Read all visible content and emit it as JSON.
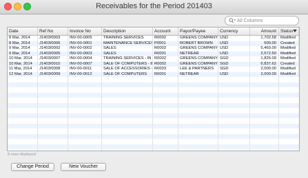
{
  "window": {
    "title": "Receivables for the Period 201403"
  },
  "search": {
    "placeholder": "All Columns"
  },
  "table": {
    "columns": [
      "Date",
      "Ref No",
      "Invoice No",
      "Description",
      "Account",
      "Payor/Payee",
      "Currency",
      "Amount",
      "Status"
    ],
    "sort_column": "Status",
    "rows": [
      [
        "8 Mar, 2014",
        "J1403/0003",
        "INV-00-0005",
        "TRAINING SERVICES",
        "R0002",
        "GREENS COMPANY",
        "USD",
        "1,702.58",
        "Modified"
      ],
      [
        "8 Mar, 2014",
        "J1403/0006",
        "INV-00-0001",
        "MAINTENANCE SERVICES",
        "P0001",
        "ROBERT BROWN",
        "USD",
        "500.00",
        "Created"
      ],
      [
        "9 Mar, 2014",
        "J1403/0002",
        "INV-00-0002",
        "SALES",
        "R0002",
        "GREENS COMPANY",
        "USD",
        "5,460.00",
        "Modified"
      ],
      [
        "9 Mar, 2014",
        "J1403/0005",
        "INV-00-0003",
        "SALES",
        "R0001",
        "NETREAR",
        "USD",
        "2,572.50",
        "Modified"
      ],
      [
        "10 Mar, 2014",
        "J1403/0007",
        "INV-00-0004",
        "TRAINING SERVICES - IN S",
        "R0002",
        "GREENS COMPANY",
        "SGD",
        "1,826.09",
        "Modified"
      ],
      [
        "10 Mar, 2014",
        "J1403/0010",
        "INV-00-0007",
        "SALE OF COMPUTERS - IN",
        "R0002",
        "GREENS COMPANY",
        "SGD",
        "6,837.62",
        "Created"
      ],
      [
        "11 Mar, 2014",
        "J1403/0008",
        "INV-00-0011",
        "SALE OF ACCESSORIES - I",
        "R0003",
        "LEE & PARTNERS",
        "SGD",
        "2,000.00",
        "Modified"
      ],
      [
        "12 Mar, 2014",
        "J1403/0009",
        "INV-00-0012",
        "SALE OF COMPUTERS",
        "R0001",
        "NETREAR",
        "USD",
        "2,000.00",
        "Modified"
      ]
    ]
  },
  "footer": {
    "rows_displayed": "8 rows displayed"
  },
  "buttons": {
    "change_period": "Change Period",
    "new_voucher": "New Voucher"
  }
}
